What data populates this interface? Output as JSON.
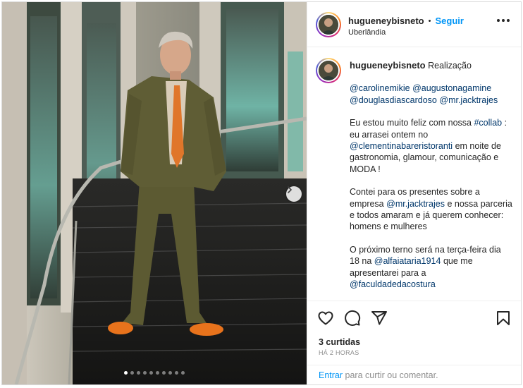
{
  "header": {
    "username": "hugueneybisneto",
    "separator": "•",
    "follow_label": "Seguir",
    "location": "Uberlândia",
    "more_icon": "more-horizontal-icon"
  },
  "caption": {
    "username": "hugueneybisneto",
    "first_line": "Realização",
    "tags_line1": "@carolinemikie @augustonagamine",
    "tags_line2a": "@douglasdiascardoso",
    "tags_line2b": "@mr.jacktrajes",
    "p2_text1": "Eu estou muito feliz com nossa",
    "p2_link1": "#collab",
    "p2_text2": ": eu arrasei ontem no",
    "p2_link2": "@clementinabareristoranti",
    "p2_text3": "em noite de gastronomia, glamour, comunicação e MODA !",
    "p3_text1": "Contei para os presentes sobre a empresa",
    "p3_link1": "@mr.jacktrajes",
    "p3_text2": "e nossa parceria e todos amaram e já querem conhecer: homens e mulheres",
    "p4_text1": "O próximo terno será na terça-feira dia 18 na",
    "p4_link1": "@alfaiataria1914",
    "p4_text2": "que me apresentarei para a",
    "p4_link2": "@faculdadedacostura"
  },
  "actions": {
    "like_icon": "heart-icon",
    "comment_icon": "comment-icon",
    "share_icon": "send-icon",
    "save_icon": "bookmark-icon",
    "likes_text": "3 curtidas",
    "time_text": "HÁ 2 HORAS"
  },
  "login_prompt": {
    "enter_label": "Entrar",
    "rest": "para curtir ou comentar."
  },
  "carousel": {
    "total_slides": 10,
    "active_slide": 1,
    "next_icon": "chevron-right-icon"
  },
  "colors": {
    "accent": "#0095f6",
    "link": "#00376b",
    "muted": "#8e8e8e",
    "suit": "#5c5a32",
    "shoes": "#e8731c"
  }
}
